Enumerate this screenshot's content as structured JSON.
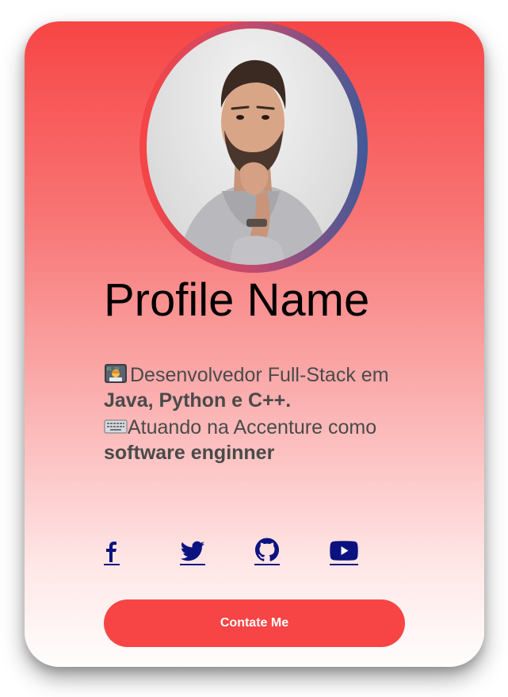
{
  "profile": {
    "name": "Profile Name"
  },
  "bio": {
    "line1_text": "Desenvolvedor Full-Stack em ",
    "line1_bold": "Java, Python e C++.",
    "line2_text": "Atuando na Accenture como ",
    "line2_bold": "software enginner",
    "line1_icon": "technologist-emoji",
    "line2_icon": "keyboard-emoji"
  },
  "socials": [
    {
      "name": "facebook",
      "icon": "facebook-icon"
    },
    {
      "name": "twitter",
      "icon": "twitter-icon"
    },
    {
      "name": "github",
      "icon": "github-icon"
    },
    {
      "name": "youtube",
      "icon": "youtube-icon"
    }
  ],
  "contact_button": {
    "label": "Contate Me"
  },
  "colors": {
    "accent": "#f74545",
    "link": "#0b1280",
    "ring_end": "#3f5a9a",
    "text": "#4a4a4a"
  }
}
